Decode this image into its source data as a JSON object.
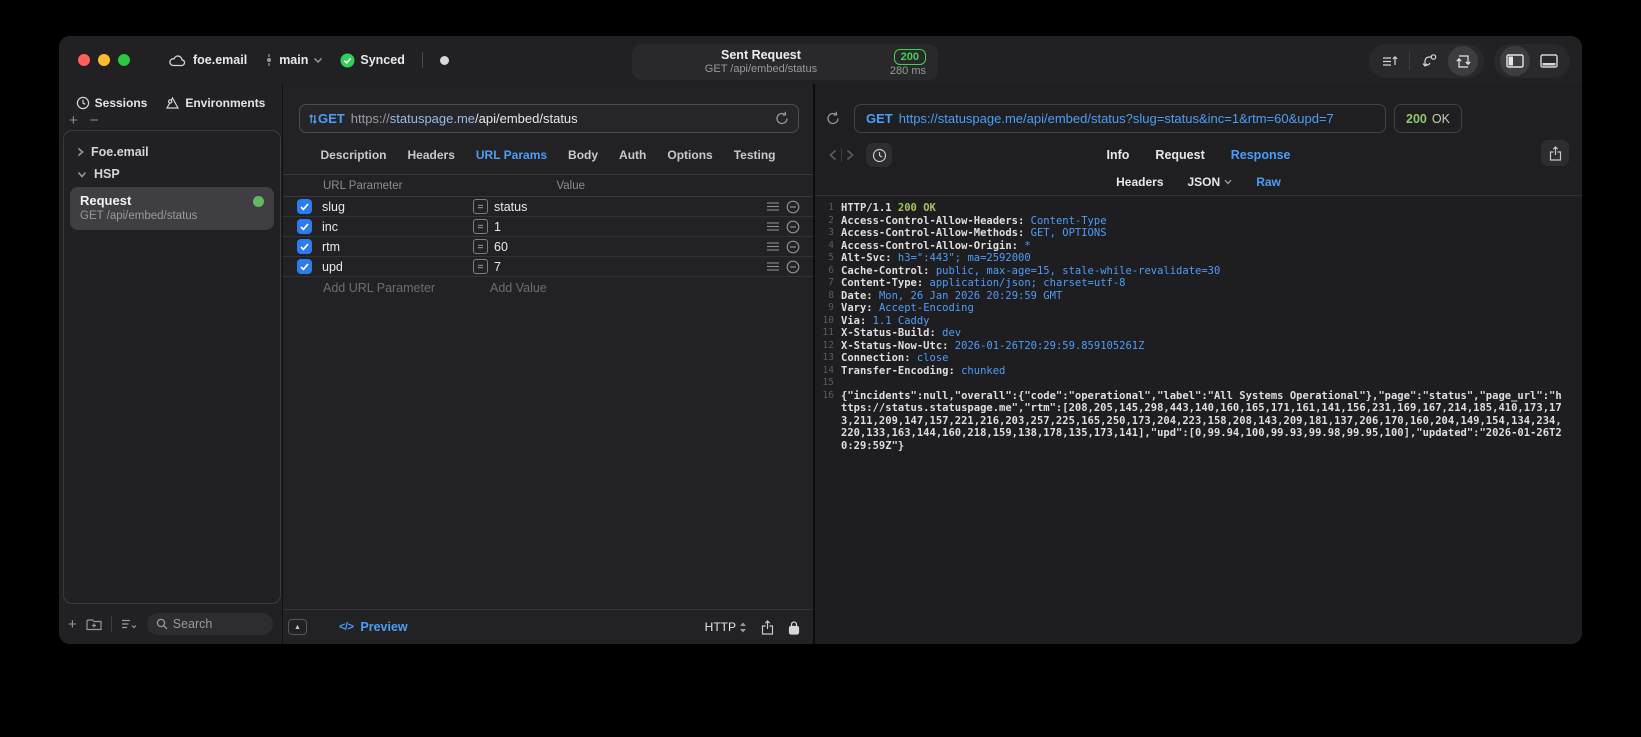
{
  "titlebar": {
    "project": "foe.email",
    "branch": "main",
    "synced": "Synced",
    "pill": {
      "title": "Sent Request",
      "subtitle": "GET /api/embed/status",
      "code": "200",
      "duration": "280 ms"
    }
  },
  "sidebar": {
    "tab_sessions": "Sessions",
    "tab_environments": "Environments",
    "group_foe": "Foe.email",
    "group_hsp": "HSP",
    "request_title": "Request",
    "request_subtitle": "GET /api/embed/status",
    "search_placeholder": "Search"
  },
  "editor": {
    "method": "GET",
    "url_scheme": "https://",
    "url_host": "statuspage.me",
    "url_path": "/api/embed/status",
    "tabs": [
      "Description",
      "Headers",
      "URL Params",
      "Body",
      "Auth",
      "Options",
      "Testing"
    ],
    "active_tab": "URL Params",
    "params": {
      "col_name": "URL Parameter",
      "col_value": "Value",
      "rows": [
        {
          "name": "slug",
          "value": "status",
          "checked": true
        },
        {
          "name": "inc",
          "value": "1",
          "checked": true
        },
        {
          "name": "rtm",
          "value": "60",
          "checked": true
        },
        {
          "name": "upd",
          "value": "7",
          "checked": true
        }
      ],
      "add_name": "Add URL Parameter",
      "add_value": "Add Value"
    },
    "footer": {
      "preview": "Preview",
      "protocol": "HTTP"
    }
  },
  "viewer": {
    "method": "GET",
    "url": "https://statuspage.me/api/embed/status?slug=status&inc=1&rtm=60&upd=7",
    "status_code": "200",
    "status_text": "OK",
    "tabs": [
      "Info",
      "Request",
      "Response"
    ],
    "active_tab": "Response",
    "subtabs": [
      "Headers",
      "JSON",
      "Raw"
    ],
    "active_subtab": "Raw",
    "body_lines": [
      {
        "num": "1",
        "seg": [
          [
            "p",
            "HTTP/1.1 "
          ],
          [
            "g",
            "200 OK"
          ]
        ]
      },
      {
        "num": "2",
        "seg": [
          [
            "p",
            "Access-Control-Allow-Headers: "
          ],
          [
            "v",
            "Content-Type"
          ]
        ]
      },
      {
        "num": "3",
        "seg": [
          [
            "p",
            "Access-Control-Allow-Methods: "
          ],
          [
            "v",
            "GET, OPTIONS"
          ]
        ]
      },
      {
        "num": "4",
        "seg": [
          [
            "p",
            "Access-Control-Allow-Origin: "
          ],
          [
            "v",
            "*"
          ]
        ]
      },
      {
        "num": "5",
        "seg": [
          [
            "p",
            "Alt-Svc: "
          ],
          [
            "v",
            "h3=\":443\"; ma=2592000"
          ]
        ]
      },
      {
        "num": "6",
        "seg": [
          [
            "p",
            "Cache-Control: "
          ],
          [
            "v",
            "public, max-age=15, stale-while-revalidate=30"
          ]
        ]
      },
      {
        "num": "7",
        "seg": [
          [
            "p",
            "Content-Type: "
          ],
          [
            "v",
            "application/json; charset=utf-8"
          ]
        ]
      },
      {
        "num": "8",
        "seg": [
          [
            "p",
            "Date: "
          ],
          [
            "v",
            "Mon, 26 Jan 2026 20:29:59 GMT"
          ]
        ]
      },
      {
        "num": "9",
        "seg": [
          [
            "p",
            "Vary: "
          ],
          [
            "v",
            "Accept-Encoding"
          ]
        ]
      },
      {
        "num": "10",
        "seg": [
          [
            "p",
            "Via: "
          ],
          [
            "v",
            "1.1 Caddy"
          ]
        ]
      },
      {
        "num": "11",
        "seg": [
          [
            "p",
            "X-Status-Build: "
          ],
          [
            "v",
            "dev"
          ]
        ]
      },
      {
        "num": "12",
        "seg": [
          [
            "p",
            "X-Status-Now-Utc: "
          ],
          [
            "v",
            "2026-01-26T20:29:59.859105261Z"
          ]
        ]
      },
      {
        "num": "13",
        "seg": [
          [
            "p",
            "Connection: "
          ],
          [
            "v",
            "close"
          ]
        ]
      },
      {
        "num": "14",
        "seg": [
          [
            "p",
            "Transfer-Encoding: "
          ],
          [
            "v",
            "chunked"
          ]
        ]
      },
      {
        "num": "15",
        "seg": []
      },
      {
        "num": "16",
        "seg": [
          [
            "p",
            "{\"incidents\":null,\"overall\":{\"code\":\"operational\",\"label\":\"All Systems Operational\"},\"page\":\"status\",\"page_url\":\"https://status.statuspage.me\",\"rtm\":[208,205,145,298,443,140,160,165,171,161,141,156,231,169,167,214,185,410,173,173,211,209,147,157,221,216,203,257,225,165,250,173,204,223,158,208,143,209,181,137,206,170,160,204,149,154,134,234,220,133,163,144,160,218,159,138,178,135,173,141],\"upd\":[0,99.94,100,99.93,99.98,99.95,100],\"updated\":\"2026-01-26T20:29:59Z\"}"
          ]
        ]
      }
    ]
  },
  "colors": {
    "accent_blue": "#4B9EF8",
    "status_green": "#3FD158",
    "code_green": "#A5C25C",
    "code_blue": "#4F9CF8"
  }
}
